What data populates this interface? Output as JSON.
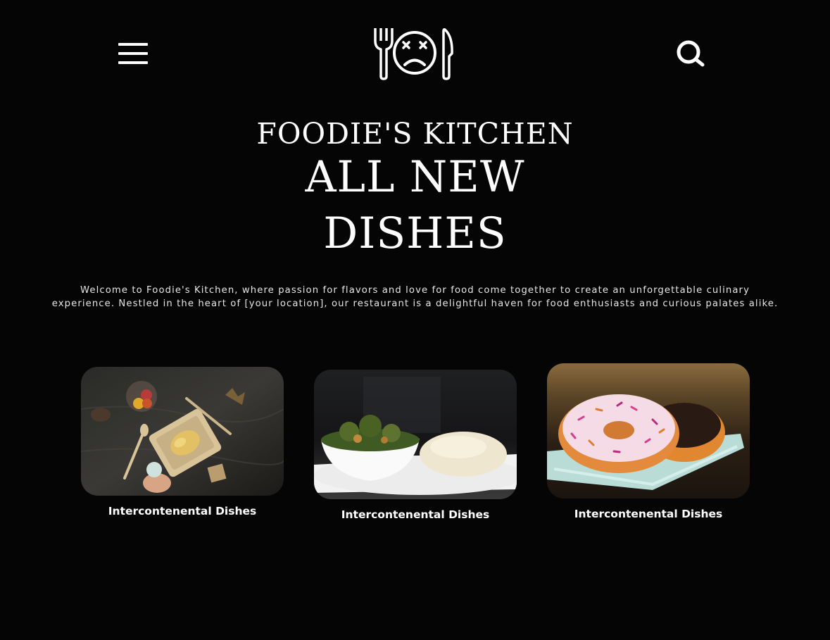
{
  "header": {
    "menu_icon": "hamburger-menu-icon",
    "logo_icon": "fork-sad-plate-knife-logo",
    "search_icon": "search-icon"
  },
  "hero": {
    "brand": "FOODIE'S KITCHEN",
    "headline_line1": "ALL NEW",
    "headline_line2": "DISHES"
  },
  "intro": {
    "line1": "Welcome to Foodie's Kitchen, where passion for flavors and love for food come together to create an unforgettable culinary",
    "line2": "experience. Nestled in the heart of [your location], our restaurant is a delightful haven for food enthusiasts and curious palates alike."
  },
  "cards": [
    {
      "caption": "Intercontenental Dishes",
      "image": "rustic-table-flatlay-photo"
    },
    {
      "caption": "Intercontenental Dishes",
      "image": "vegetable-soup-and-swallow-photo"
    },
    {
      "caption": "Intercontenental Dishes",
      "image": "sprinkled-donuts-photo"
    }
  ],
  "colors": {
    "background": "#050505",
    "text": "#ffffff"
  }
}
